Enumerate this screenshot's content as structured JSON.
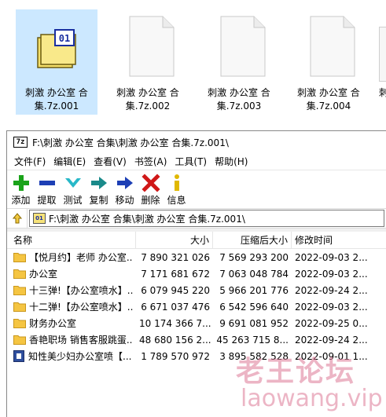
{
  "explorer": {
    "files": [
      {
        "name": "刺激 办公室 合集.7z.001",
        "type": "archive",
        "selected": true
      },
      {
        "name": "刺激 办公室 合集.7z.002",
        "type": "document",
        "selected": false
      },
      {
        "name": "刺激 办公室 合集.7z.003",
        "type": "document",
        "selected": false
      },
      {
        "name": "刺激 办公室 合集.7z.004",
        "type": "document",
        "selected": false
      }
    ],
    "partial_text": "刺"
  },
  "window": {
    "app_logo": "7z",
    "title": "F:\\刺激 办公室 合集\\刺激 办公室 合集.7z.001\\",
    "menu": [
      "文件(F)",
      "编辑(E)",
      "查看(V)",
      "书签(A)",
      "工具(T)",
      "帮助(H)"
    ],
    "toolbar": [
      {
        "label": "添加",
        "icon": "add-icon",
        "color": "#1aa31a"
      },
      {
        "label": "提取",
        "icon": "extract-icon",
        "color": "#1d3fb5"
      },
      {
        "label": "测试",
        "icon": "test-icon",
        "color": "#28b8c8"
      },
      {
        "label": "复制",
        "icon": "copy-icon",
        "color": "#1a8a8a"
      },
      {
        "label": "移动",
        "icon": "move-icon",
        "color": "#1d3fb5"
      },
      {
        "label": "删除",
        "icon": "delete-icon",
        "color": "#d01818"
      },
      {
        "label": "信息",
        "icon": "info-icon",
        "color": "#e0b800"
      }
    ],
    "address": "F:\\刺激 办公室 合集\\刺激 办公室 合集.7z.001\\",
    "columns": {
      "name": "名称",
      "size": "大小",
      "packed": "压缩后大小",
      "modified": "修改时间"
    },
    "rows": [
      {
        "name": "【悦月约】老师 办公室...",
        "size": "7 890 321 026",
        "packed": "7 569 293 200",
        "modified": "2022-09-03 2...",
        "type": "folder"
      },
      {
        "name": "办公室",
        "size": "7 171 681 672",
        "packed": "7 063 048 784",
        "modified": "2022-09-03 2...",
        "type": "folder"
      },
      {
        "name": "十三弹!【办公室喷水】...",
        "size": "6 079 945 220",
        "packed": "5 966 201 776",
        "modified": "2022-09-24 2...",
        "type": "folder"
      },
      {
        "name": "十二弹!【办公室喷水】...",
        "size": "6 671 037 476",
        "packed": "6 542 596 640",
        "modified": "2022-09-03 2...",
        "type": "folder"
      },
      {
        "name": "财务办公室",
        "size": "10 174 366 7...",
        "packed": "9 691 081 952",
        "modified": "2022-09-25 0...",
        "type": "folder"
      },
      {
        "name": "香艳职场 销售客服跳蛋...",
        "size": "48 680 156 2...",
        "packed": "45 263 715 8...",
        "modified": "2022-09-24 2...",
        "type": "folder"
      },
      {
        "name": "知性美少妇办公室喷【...",
        "size": "1 789 570 972",
        "packed": "3 895 582 528",
        "modified": "2022-09-01 1...",
        "type": "file"
      }
    ]
  },
  "watermark": {
    "cn": "老王论坛",
    "en": "laowang.vip"
  },
  "colors": {
    "selection": "#cce8ff",
    "folder": "#f5c542",
    "watermark": "#dc7896"
  }
}
